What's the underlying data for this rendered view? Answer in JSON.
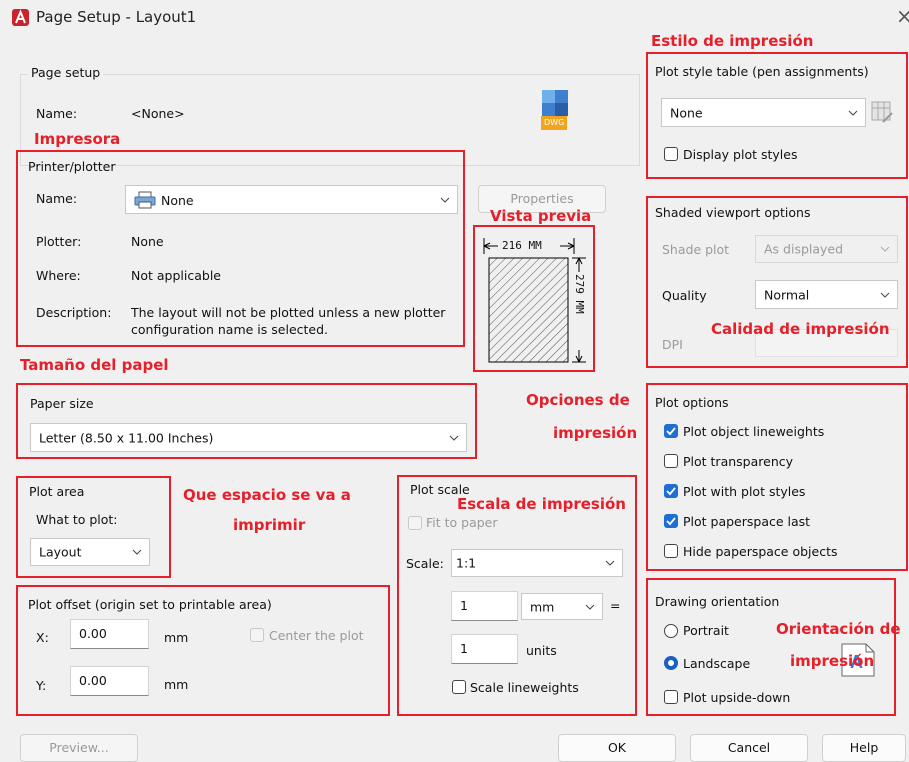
{
  "window": {
    "title": "Page Setup - Layout1",
    "close": "×"
  },
  "page_setup": {
    "title": "Page setup",
    "name_label": "Name:",
    "name_value": "<None>",
    "dwg_badge": "DWG"
  },
  "printer": {
    "title": "Printer/plotter",
    "name_label": "Name:",
    "name_value": "None",
    "properties_button": "Properties",
    "plotter_label": "Plotter:",
    "plotter_value": "None",
    "where_label": "Where:",
    "where_value": "Not applicable",
    "description_label": "Description:",
    "description_line1": "The layout will not be plotted unless a new plotter",
    "description_line2": "configuration name is selected."
  },
  "preview": {
    "width_label": "216  MM",
    "height_label": "279  MM"
  },
  "paper_size": {
    "title": "Paper size",
    "value": "Letter (8.50 x 11.00 Inches)"
  },
  "plot_area": {
    "title": "Plot area",
    "what_label": "What to plot:",
    "value": "Layout"
  },
  "plot_offset": {
    "title": "Plot offset (origin set to printable area)",
    "x_label": "X:",
    "x_value": "0.00",
    "x_unit": "mm",
    "y_label": "Y:",
    "y_value": "0.00",
    "y_unit": "mm",
    "center_label": "Center the plot",
    "center_checked": false
  },
  "plot_scale": {
    "title": "Plot scale",
    "fit_label": "Fit to paper",
    "fit_checked": false,
    "scale_label": "Scale:",
    "scale_value": "1:1",
    "value1": "1",
    "unit1": "mm",
    "equals": "=",
    "value2": "1",
    "unit2": "units",
    "lineweights_label": "Scale lineweights",
    "lineweights_checked": false
  },
  "plot_style": {
    "title": "Plot style table (pen assignments)",
    "value": "None",
    "display_label": "Display plot styles",
    "display_checked": false
  },
  "shaded": {
    "title": "Shaded viewport options",
    "shade_label": "Shade plot",
    "shade_value": "As displayed",
    "quality_label": "Quality",
    "quality_value": "Normal",
    "dpi_label": "DPI"
  },
  "plot_options": {
    "title": "Plot options",
    "items": [
      {
        "label": "Plot object lineweights",
        "checked": true
      },
      {
        "label": "Plot transparency",
        "checked": false
      },
      {
        "label": "Plot with plot styles",
        "checked": true
      },
      {
        "label": "Plot paperspace last",
        "checked": true
      },
      {
        "label": "Hide paperspace objects",
        "checked": false
      }
    ]
  },
  "orientation": {
    "title": "Drawing orientation",
    "portrait": "Portrait",
    "landscape": "Landscape",
    "selected": "Landscape",
    "upside_down": "Plot upside-down",
    "upside_down_checked": false
  },
  "buttons": {
    "preview": "Preview...",
    "ok": "OK",
    "cancel": "Cancel",
    "help": "Help"
  },
  "annotations": {
    "estilo": "Estilo de impresión",
    "impresora": "Impresora",
    "vista_previa": "Vista previa",
    "tamano": "Tamaño del papel",
    "opciones_1": "Opciones de",
    "opciones_2": "impresión",
    "que_espacio_1": "Que espacio se va a",
    "que_espacio_2": "imprimir",
    "escala": "Escala de impresión",
    "calidad": "Calidad de impresión",
    "orientacion_1": "Orientación de",
    "orientacion_2": "impresión"
  },
  "colors": {
    "annotation_red": "#e5202a",
    "checkbox_blue": "#1e6fd1",
    "app_icon_red": "#c8242b"
  }
}
